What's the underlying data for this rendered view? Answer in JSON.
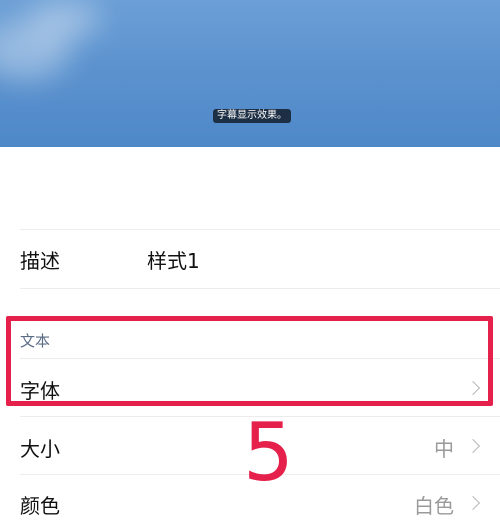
{
  "preview": {
    "caption": "字幕显示效果。"
  },
  "description": {
    "label": "描述",
    "value": "样式1"
  },
  "text_section": {
    "title": "文本",
    "font": {
      "label": "字体"
    }
  },
  "size": {
    "label": "大小",
    "value": "中"
  },
  "color": {
    "label": "颜色",
    "value": "白色"
  },
  "annotation": {
    "step_number": "5",
    "highlight_color": "#e5204a"
  }
}
